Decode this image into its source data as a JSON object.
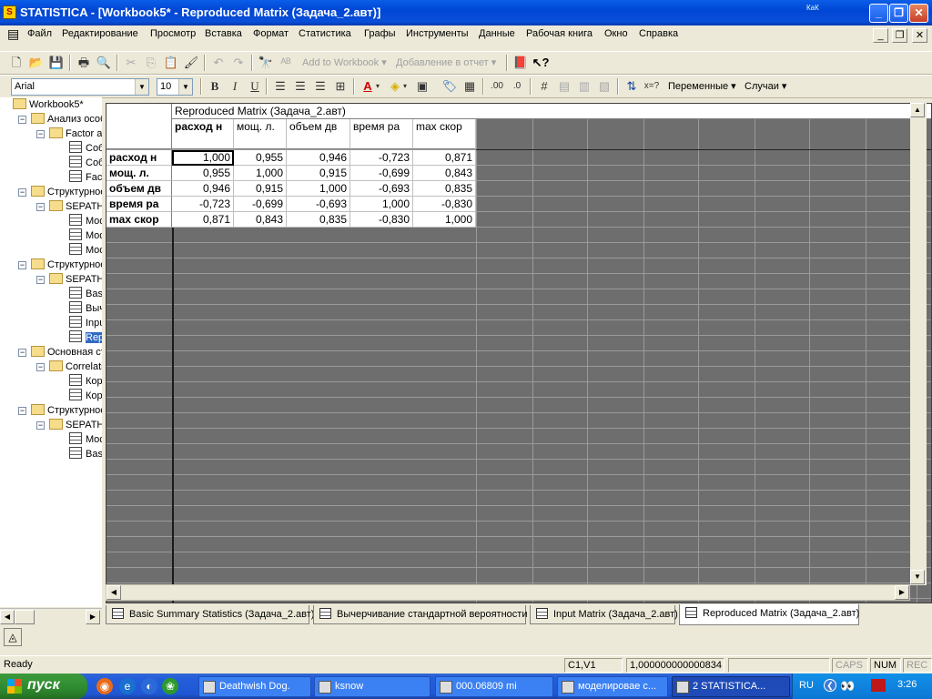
{
  "window": {
    "title": "STATISTICA - [Workbook5* - Reproduced Matrix (Задача_2.авт)]",
    "corner_text": "КаК",
    "app_icon": "statistica-icon"
  },
  "menu": [
    "Файл",
    "Редактирование",
    "Просмотр",
    "Вставка",
    "Формат",
    "Статистика",
    "Графы",
    "Инструменты",
    "Данные",
    "Рабочая книга",
    "Окно",
    "Справка"
  ],
  "toolbar1": {
    "add_to_workbook": "Add to Workbook",
    "add_to_report": "Добавление в отчет"
  },
  "toolbar2": {
    "font": "Arial",
    "size": "10",
    "bold": "B",
    "italic": "I",
    "underline": "U",
    "variables": "Переменные",
    "cases": "Случаи"
  },
  "tree": [
    {
      "label": "Workbook5*",
      "depth": 0,
      "type": "folder"
    },
    {
      "label": "Анализ особен",
      "depth": 1,
      "type": "folder"
    },
    {
      "label": "Factor anal",
      "depth": 2,
      "type": "folder"
    },
    {
      "label": "Собстве",
      "depth": 3,
      "type": "sheet"
    },
    {
      "label": "Собстве",
      "depth": 3,
      "type": "sheet"
    },
    {
      "label": "Factor l",
      "depth": 3,
      "type": "sheet"
    },
    {
      "label": "Структурное",
      "depth": 1,
      "type": "folder"
    },
    {
      "label": "SEPATH re",
      "depth": 2,
      "type": "folder"
    },
    {
      "label": "Model I",
      "depth": 3,
      "type": "sheet"
    },
    {
      "label": "Model I",
      "depth": 3,
      "type": "sheet"
    },
    {
      "label": "Model I",
      "depth": 3,
      "type": "sheet"
    },
    {
      "label": "Структурное",
      "depth": 1,
      "type": "folder"
    },
    {
      "label": "SEPATH re",
      "depth": 2,
      "type": "folder"
    },
    {
      "label": "Basic S",
      "depth": 3,
      "type": "sheet"
    },
    {
      "label": "Вычер",
      "depth": 3,
      "type": "graph"
    },
    {
      "label": "Input M",
      "depth": 3,
      "type": "sheet"
    },
    {
      "label": "Reproc",
      "depth": 3,
      "type": "sheet",
      "selected": true
    },
    {
      "label": "Основная ста",
      "depth": 1,
      "type": "folder"
    },
    {
      "label": "Correlation",
      "depth": 2,
      "type": "folder"
    },
    {
      "label": "Корре.",
      "depth": 3,
      "type": "sheet"
    },
    {
      "label": "Корре.",
      "depth": 3,
      "type": "sheet"
    },
    {
      "label": "Структурное",
      "depth": 1,
      "type": "folder"
    },
    {
      "label": "SEPATH re",
      "depth": 2,
      "type": "folder"
    },
    {
      "label": "Model I",
      "depth": 3,
      "type": "sheet"
    },
    {
      "label": "Basic S",
      "depth": 3,
      "type": "sheet"
    }
  ],
  "spreadsheet": {
    "title": "Reproduced Matrix (Задача_2.авт)",
    "columns": [
      "расход н",
      "мощ.  л.",
      "объем дв",
      "время ра",
      "max скор"
    ],
    "rows": [
      {
        "label": "расход н",
        "values": [
          "1,000",
          "0,955",
          "0,946",
          "-0,723",
          "0,871"
        ]
      },
      {
        "label": "мощ.  л.",
        "values": [
          "0,955",
          "1,000",
          "0,915",
          "-0,699",
          "0,843"
        ]
      },
      {
        "label": "объем дв",
        "values": [
          "0,946",
          "0,915",
          "1,000",
          "-0,693",
          "0,835"
        ]
      },
      {
        "label": "время ра",
        "values": [
          "-0,723",
          "-0,699",
          "-0,693",
          "1,000",
          "-0,830"
        ]
      },
      {
        "label": "max скор",
        "values": [
          "0,871",
          "0,843",
          "0,835",
          "-0,830",
          "1,000"
        ]
      }
    ]
  },
  "tabs": [
    {
      "label": "Basic Summary Statistics (Задача_2.авт)",
      "active": false
    },
    {
      "label": "Вычерчивание стандартной вероятности",
      "active": false
    },
    {
      "label": "Input Matrix (Задача_2.авт)",
      "active": false
    },
    {
      "label": "Reproduced Matrix (Задача_2.авт)",
      "active": true
    }
  ],
  "status": {
    "ready": "Ready",
    "cell": "C1,V1",
    "value": "1,000000000000834",
    "caps": "CAPS",
    "num": "NUM",
    "rec": "REC"
  },
  "taskbar": {
    "start": "пуск",
    "tasks": [
      {
        "label": "Deathwish Dog.",
        "active": false
      },
      {
        "label": "ksnow",
        "active": false
      },
      {
        "label": "000.06809 mi",
        "active": false
      },
      {
        "label": "моделировае с...",
        "active": false
      },
      {
        "label": "2 STATISTICA...",
        "active": true
      }
    ],
    "lang": "RU",
    "clock": "3:26"
  }
}
